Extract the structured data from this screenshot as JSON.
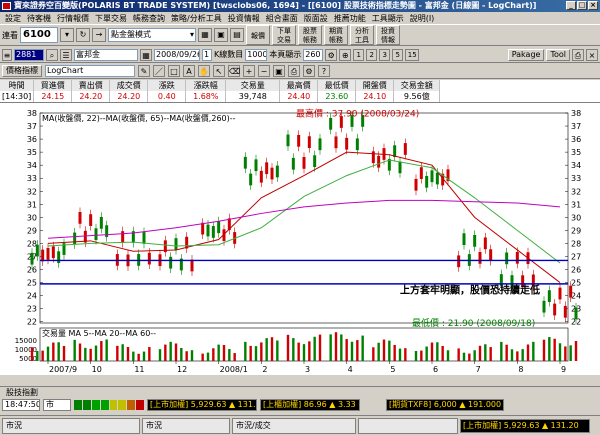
{
  "window": {
    "title": "寶來證券空百變版(POLARIS BT TRADE SYSTEM) [twsclobs06, 1694] - [[6100] 股票技術指標走勢圖 - 富邦金 (日線圖 - LogChart)]"
  },
  "menu": [
    "設定",
    "待客機",
    "行情報價",
    "下單交易",
    "帳務查詢",
    "策略/分析工具",
    "投資情報",
    "組合畫面",
    "版面設",
    "推薦功能",
    "工具顯示",
    "說明(I)"
  ],
  "toolbar": {
    "code_label": "連看",
    "code_value": "6100",
    "mode_select": "點金盤模式",
    "buttons": [
      "報價",
      "下單\n交易",
      "股票\n帳務",
      "期貨\n帳務",
      "分析\n工具",
      "投資\n情報"
    ]
  },
  "ctrl": {
    "stock_code": "2881",
    "stock_name": "富邦金",
    "date": "2008/09/26",
    "interval": "1",
    "interval_unit": "K線數目",
    "kcount": "1000",
    "display_label": "本頁顯示",
    "display_count": "260",
    "presets": [
      "1",
      "2",
      "3",
      "5",
      "15"
    ],
    "right_buttons": [
      "Pakage",
      "Tool"
    ]
  },
  "bar3": {
    "indicator_btn": "價格指標",
    "chart_mode": "LogChart"
  },
  "ticker": {
    "headers": [
      "時間",
      "買進價",
      "賣出價",
      "成交價",
      "漲跌",
      "漲跌幅",
      "交易量",
      "最高價",
      "最低價",
      "開盤價",
      "交易金額"
    ],
    "values": [
      "[14:30]",
      "24.15",
      "24.20",
      "24.20",
      "0.40",
      "1.68%",
      "39,748",
      "24.40",
      "23.60",
      "24.10",
      "9.56億"
    ]
  },
  "chart_data": {
    "type": "line",
    "legend": "MA(收盤價, 22)--MA(收盤價, 65)--MA(收盤價,260)--",
    "x_ticks": [
      "2007/9",
      "10",
      "11",
      "12",
      "2008/1",
      "2",
      "3",
      "4",
      "5",
      "6",
      "7",
      "8",
      "9"
    ],
    "y_ticks": [
      38,
      37,
      36,
      35,
      34,
      33,
      32,
      31,
      30,
      29,
      28,
      27,
      26,
      25,
      24,
      23,
      22
    ],
    "ylim": [
      21.9,
      38
    ],
    "series": [
      {
        "name": "MA(收盤價, 22)",
        "color": "#c00000",
        "x": [
          "2007/9",
          "10",
          "11",
          "12",
          "2008/1",
          "2",
          "3",
          "4",
          "5",
          "6",
          "7",
          "8",
          "9"
        ],
        "values": [
          28.0,
          28.2,
          27.4,
          27.5,
          28.3,
          31.5,
          33.2,
          35.0,
          34.8,
          34.0,
          30.0,
          27.5,
          25.0
        ]
      },
      {
        "name": "MA(收盤價, 65)",
        "color": "#40b040",
        "x": [
          "2007/9",
          "10",
          "11",
          "12",
          "2008/1",
          "2",
          "3",
          "4",
          "5",
          "6",
          "7",
          "8",
          "9"
        ],
        "values": [
          27.8,
          28.0,
          28.1,
          27.8,
          27.9,
          29.2,
          31.6,
          33.2,
          34.4,
          33.8,
          31.5,
          29.0,
          26.5
        ]
      },
      {
        "name": "MA(收盤價,260)",
        "color": "#c000c0",
        "x": [
          "2007/9",
          "10",
          "11",
          "12",
          "2008/1",
          "2",
          "3",
          "4",
          "5",
          "6",
          "7",
          "8",
          "9"
        ],
        "values": [
          28.4,
          28.6,
          28.8,
          29.2,
          29.7,
          30.3,
          30.8,
          31.1,
          31.3,
          31.3,
          31.2,
          31.1,
          30.8
        ]
      }
    ],
    "candles": [
      {
        "x": "2007/9",
        "v": 27.2
      },
      {
        "x": "10",
        "v": 29.2
      },
      {
        "x": "11",
        "v": 27.6
      },
      {
        "x": "12",
        "v": 27.2
      },
      {
        "x": "2008/1",
        "v": 29.0
      },
      {
        "x": "2",
        "v": 33.5
      },
      {
        "x": "3",
        "v": 35.0
      },
      {
        "x": "4",
        "v": 36.5
      },
      {
        "x": "5",
        "v": 34.5
      },
      {
        "x": "6",
        "v": 33.0
      },
      {
        "x": "7",
        "v": 27.5
      },
      {
        "x": "8",
        "v": 26.0
      },
      {
        "x": "9",
        "v": 23.5
      }
    ],
    "hlines": [
      {
        "value": 26.7,
        "color": "#0000c0"
      },
      {
        "value": 24.9,
        "color": "#0000c0"
      }
    ],
    "high_annotation": "最高價 : 37.90 (2008/03/24)",
    "low_annotation": "最低價 : 21.90 (2008/09/18)",
    "comment": "上方套牢明顯，股價恐持續走低",
    "volume_legend": "交易量 MA  5--MA 20--MA 60--",
    "volume_ticks": [
      "15000",
      "10000",
      "5000"
    ],
    "volume_values": [
      6,
      7,
      5,
      6,
      5,
      8,
      9,
      10,
      7,
      6,
      5,
      6,
      8
    ]
  },
  "divider": {
    "label": "股技指劃"
  },
  "status": {
    "time": "18:47:50",
    "market": "市",
    "index1_label": "[上市加權]",
    "index1_value": "5,929.63",
    "index1_change": "131.20",
    "index2_label": "[上櫃加權]",
    "index2_value": "86.96",
    "index2_change": "3.33",
    "index3_label": "[期貨TXF8]",
    "index3_value": "6,000",
    "index3_change": "191.000"
  },
  "bottom": {
    "left": "市況",
    "middle1": "市況",
    "middle2": "市況/成交",
    "right_label": "[上市加權]",
    "right_value": "5,929.63",
    "right_change": "131.20"
  }
}
